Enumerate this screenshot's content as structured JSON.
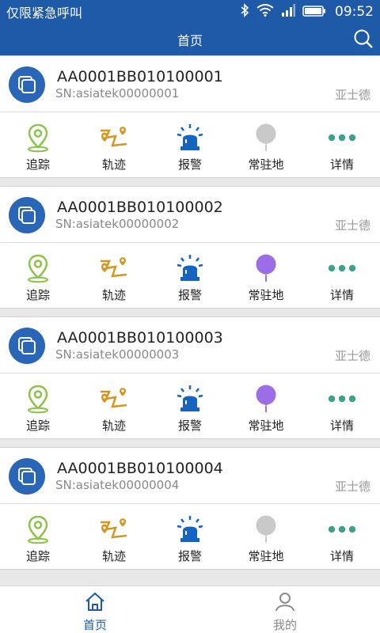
{
  "status_bar": {
    "carrier": "仅限紧急呼叫",
    "time": "09:52"
  },
  "nav": {
    "title": "首页"
  },
  "colors": {
    "brand": "#1e5aa8",
    "track": "#8bc34a",
    "route": "#d4961e",
    "alarm": "#1565c0",
    "station_active": "#9c6ee6",
    "station_inactive": "#c8c8c8",
    "more": "#3aa38a"
  },
  "devices": [
    {
      "name": "AA0001BB010100001",
      "sn": "SN:asiatek00000001",
      "owner": "亚士德",
      "station_active": false
    },
    {
      "name": "AA0001BB010100002",
      "sn": "SN:asiatek00000002",
      "owner": "亚士德",
      "station_active": true
    },
    {
      "name": "AA0001BB010100003",
      "sn": "SN:asiatek00000003",
      "owner": "亚士德",
      "station_active": true
    },
    {
      "name": "AA0001BB010100004",
      "sn": "SN:asiatek00000004",
      "owner": "亚士德",
      "station_active": false
    }
  ],
  "actions": [
    {
      "key": "track",
      "label": "追踪",
      "icon": "location-pin-icon"
    },
    {
      "key": "route",
      "label": "轨迹",
      "icon": "route-icon"
    },
    {
      "key": "alarm",
      "label": "报警",
      "icon": "alarm-light-icon"
    },
    {
      "key": "station",
      "label": "常驻地",
      "icon": "balloon-pin-icon"
    },
    {
      "key": "more",
      "label": "详情",
      "icon": "more-dots-icon"
    }
  ],
  "tabs": [
    {
      "key": "home",
      "label": "首页",
      "icon": "home-icon",
      "active": true
    },
    {
      "key": "mine",
      "label": "我的",
      "icon": "person-icon",
      "active": false
    }
  ]
}
